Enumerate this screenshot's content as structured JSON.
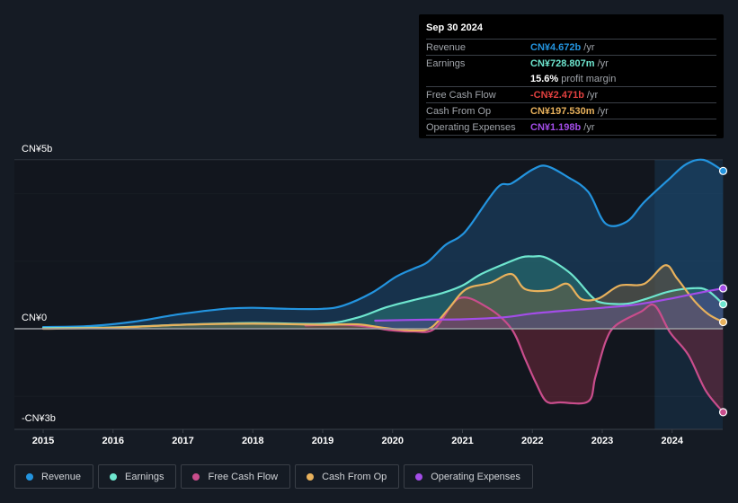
{
  "tooltip": {
    "date": "Sep 30 2024",
    "rows": [
      {
        "label": "Revenue",
        "value": "CN¥4.672b",
        "unit": "/yr",
        "color": "#2394df"
      },
      {
        "label": "Earnings",
        "value": "CN¥728.807m",
        "unit": "/yr",
        "color": "#6ee6cf"
      },
      {
        "label": "Free Cash Flow",
        "value": "-CN¥2.471b",
        "unit": "/yr",
        "color": "#e2403f"
      },
      {
        "label": "Cash From Op",
        "value": "CN¥197.530m",
        "unit": "/yr",
        "color": "#e8b15c"
      },
      {
        "label": "Operating Expenses",
        "value": "CN¥1.198b",
        "unit": "/yr",
        "color": "#a34de8"
      }
    ],
    "profit_margin_value": "15.6%",
    "profit_margin_label": "profit margin"
  },
  "legend": [
    {
      "label": "Revenue",
      "color": "#2394df"
    },
    {
      "label": "Earnings",
      "color": "#6ee6cf"
    },
    {
      "label": "Free Cash Flow",
      "color": "#c94d8c"
    },
    {
      "label": "Cash From Op",
      "color": "#e8b15c"
    },
    {
      "label": "Operating Expenses",
      "color": "#a34de8"
    }
  ],
  "chart_data": {
    "type": "area",
    "title": "",
    "xlabel": "",
    "ylabel": "",
    "currency": "CN¥",
    "unit": "billions",
    "ylim": [
      -3,
      5
    ],
    "xlim": [
      2014.6,
      2024.75
    ],
    "y_tick_labels": [
      {
        "value": 5,
        "label": "CN¥5b"
      },
      {
        "value": 0,
        "label": "CN¥0"
      },
      {
        "value": -3,
        "label": "-CN¥3b"
      }
    ],
    "gridlines": [
      4,
      2,
      -2
    ],
    "x_tick_labels": [
      "2015",
      "2016",
      "2017",
      "2018",
      "2019",
      "2020",
      "2021",
      "2022",
      "2023",
      "2024"
    ],
    "x_ticks": [
      2015,
      2016,
      2017,
      2018,
      2019,
      2020,
      2021,
      2022,
      2023,
      2024
    ],
    "highlight_range": [
      2023.75,
      2024.75
    ],
    "series": [
      {
        "name": "Revenue",
        "color": "#2394df",
        "points": [
          [
            2015.0,
            0.05
          ],
          [
            2015.67,
            0.08
          ],
          [
            2016.3,
            0.21
          ],
          [
            2016.95,
            0.43
          ],
          [
            2017.6,
            0.59
          ],
          [
            2018.0,
            0.62
          ],
          [
            2018.5,
            0.59
          ],
          [
            2019.0,
            0.59
          ],
          [
            2019.3,
            0.69
          ],
          [
            2019.7,
            1.06
          ],
          [
            2020.05,
            1.54
          ],
          [
            2020.3,
            1.78
          ],
          [
            2020.5,
            1.97
          ],
          [
            2020.75,
            2.47
          ],
          [
            2020.95,
            2.71
          ],
          [
            2021.1,
            3.03
          ],
          [
            2021.5,
            4.18
          ],
          [
            2021.7,
            4.3
          ],
          [
            2022.0,
            4.71
          ],
          [
            2022.2,
            4.82
          ],
          [
            2022.5,
            4.5
          ],
          [
            2022.8,
            4.05
          ],
          [
            2023.05,
            3.11
          ],
          [
            2023.35,
            3.17
          ],
          [
            2023.6,
            3.75
          ],
          [
            2023.95,
            4.42
          ],
          [
            2024.2,
            4.87
          ],
          [
            2024.45,
            5.0
          ],
          [
            2024.73,
            4.672
          ]
        ]
      },
      {
        "name": "Earnings",
        "color": "#6ee6cf",
        "points": [
          [
            2015.0,
            0.02
          ],
          [
            2016.0,
            0.04
          ],
          [
            2017.0,
            0.12
          ],
          [
            2018.0,
            0.17
          ],
          [
            2019.0,
            0.15
          ],
          [
            2019.5,
            0.33
          ],
          [
            2019.9,
            0.63
          ],
          [
            2020.3,
            0.85
          ],
          [
            2020.7,
            1.05
          ],
          [
            2021.0,
            1.28
          ],
          [
            2021.25,
            1.6
          ],
          [
            2021.6,
            1.92
          ],
          [
            2021.85,
            2.12
          ],
          [
            2022.0,
            2.14
          ],
          [
            2022.2,
            2.1
          ],
          [
            2022.55,
            1.63
          ],
          [
            2022.85,
            0.95
          ],
          [
            2023.0,
            0.77
          ],
          [
            2023.35,
            0.74
          ],
          [
            2023.65,
            0.9
          ],
          [
            2023.95,
            1.1
          ],
          [
            2024.3,
            1.2
          ],
          [
            2024.5,
            1.14
          ],
          [
            2024.73,
            0.729
          ]
        ]
      },
      {
        "name": "Free Cash Flow",
        "color": "#c94d8c",
        "points": [
          [
            2018.75,
            0.1
          ],
          [
            2019.3,
            0.12
          ],
          [
            2019.65,
            0.06
          ],
          [
            2019.95,
            -0.04
          ],
          [
            2020.3,
            -0.08
          ],
          [
            2020.6,
            0.0
          ],
          [
            2020.95,
            0.9
          ],
          [
            2021.35,
            0.64
          ],
          [
            2021.7,
            0.0
          ],
          [
            2021.9,
            -0.91
          ],
          [
            2022.05,
            -1.6
          ],
          [
            2022.2,
            -2.15
          ],
          [
            2022.4,
            -2.18
          ],
          [
            2022.8,
            -2.15
          ],
          [
            2022.9,
            -1.44
          ],
          [
            2023.05,
            -0.37
          ],
          [
            2023.2,
            0.11
          ],
          [
            2023.55,
            0.5
          ],
          [
            2023.75,
            0.69
          ],
          [
            2023.97,
            -0.11
          ],
          [
            2024.23,
            -0.77
          ],
          [
            2024.48,
            -1.83
          ],
          [
            2024.73,
            -2.471
          ]
        ]
      },
      {
        "name": "Cash From Op",
        "color": "#e8b15c",
        "points": [
          [
            2015.0,
            0.0
          ],
          [
            2016.0,
            0.03
          ],
          [
            2017.0,
            0.12
          ],
          [
            2018.0,
            0.15
          ],
          [
            2019.0,
            0.12
          ],
          [
            2019.5,
            0.13
          ],
          [
            2019.9,
            0.02
          ],
          [
            2020.3,
            -0.05
          ],
          [
            2020.55,
            0.03
          ],
          [
            2020.8,
            0.59
          ],
          [
            2021.05,
            1.17
          ],
          [
            2021.4,
            1.36
          ],
          [
            2021.7,
            1.62
          ],
          [
            2021.9,
            1.17
          ],
          [
            2022.25,
            1.14
          ],
          [
            2022.5,
            1.33
          ],
          [
            2022.7,
            0.88
          ],
          [
            2022.95,
            0.9
          ],
          [
            2023.25,
            1.28
          ],
          [
            2023.6,
            1.33
          ],
          [
            2023.9,
            1.88
          ],
          [
            2024.07,
            1.49
          ],
          [
            2024.32,
            0.82
          ],
          [
            2024.52,
            0.43
          ],
          [
            2024.73,
            0.198
          ]
        ]
      },
      {
        "name": "Operating Expenses",
        "color": "#a34de8",
        "points": [
          [
            2019.75,
            0.24
          ],
          [
            2020.5,
            0.27
          ],
          [
            2021.0,
            0.28
          ],
          [
            2021.6,
            0.34
          ],
          [
            2022.0,
            0.45
          ],
          [
            2022.5,
            0.54
          ],
          [
            2023.0,
            0.62
          ],
          [
            2023.5,
            0.72
          ],
          [
            2024.0,
            0.9
          ],
          [
            2024.3,
            1.03
          ],
          [
            2024.73,
            1.198
          ]
        ]
      }
    ]
  }
}
